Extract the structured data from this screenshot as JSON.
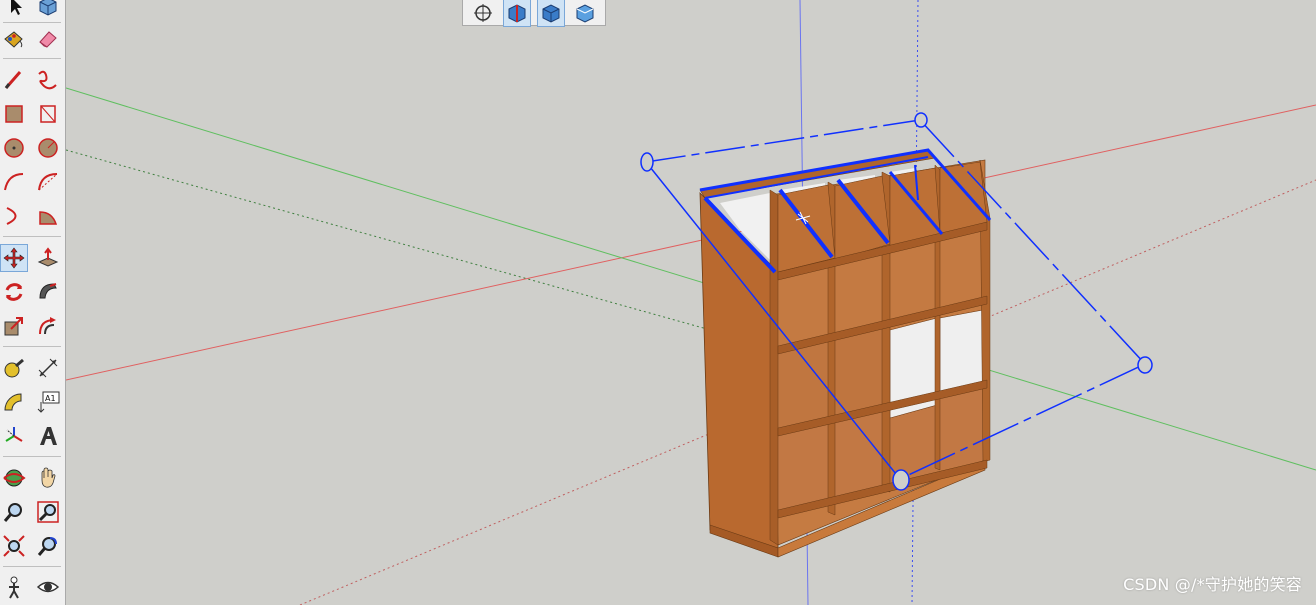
{
  "app": {
    "toolbar_left_tools": [
      {
        "name": "select-icon"
      },
      {
        "name": "component-icon"
      },
      {
        "name": "paint-bucket-icon"
      },
      {
        "name": "eraser-icon"
      },
      {
        "name": "line-icon"
      },
      {
        "name": "freehand-icon"
      },
      {
        "name": "rectangle-icon"
      },
      {
        "name": "rotated-rectangle-icon"
      },
      {
        "name": "circle-icon"
      },
      {
        "name": "polygon-icon"
      },
      {
        "name": "arc-icon"
      },
      {
        "name": "two-point-arc-icon"
      },
      {
        "name": "three-point-arc-icon"
      },
      {
        "name": "pie-icon"
      },
      {
        "name": "move-icon",
        "active": true
      },
      {
        "name": "push-pull-icon"
      },
      {
        "name": "rotate-icon"
      },
      {
        "name": "follow-me-icon"
      },
      {
        "name": "scale-icon"
      },
      {
        "name": "offset-icon"
      },
      {
        "name": "tape-measure-icon"
      },
      {
        "name": "dimension-icon"
      },
      {
        "name": "protractor-icon"
      },
      {
        "name": "text-icon",
        "text": "A1"
      },
      {
        "name": "axes-icon"
      },
      {
        "name": "3d-text-icon"
      },
      {
        "name": "orbit-icon"
      },
      {
        "name": "pan-icon"
      },
      {
        "name": "zoom-icon"
      },
      {
        "name": "zoom-window-icon"
      },
      {
        "name": "zoom-extents-icon"
      },
      {
        "name": "previous-view-icon"
      },
      {
        "name": "walk-icon"
      },
      {
        "name": "look-around-icon"
      }
    ],
    "toolbar_top_tools": [
      {
        "name": "position-camera-icon"
      },
      {
        "name": "section-plane-icon",
        "active": true
      },
      {
        "name": "display-section-planes-icon",
        "active": true
      },
      {
        "name": "display-section-cuts-icon"
      }
    ]
  },
  "viewport": {
    "axis_colors": {
      "red": "#e06060",
      "green": "#5fbf5f",
      "blue": "#3a4cf0"
    },
    "model": "slanted cubby shelf with selection box",
    "colors": {
      "wood_front": "#c87a3c",
      "wood_side": "#b8652c",
      "wood_dark": "#8a4a1c",
      "selection": "#1030ff",
      "white_panel": "#efefef"
    }
  },
  "watermark": {
    "text": "CSDN @/*守护她的笑容"
  }
}
